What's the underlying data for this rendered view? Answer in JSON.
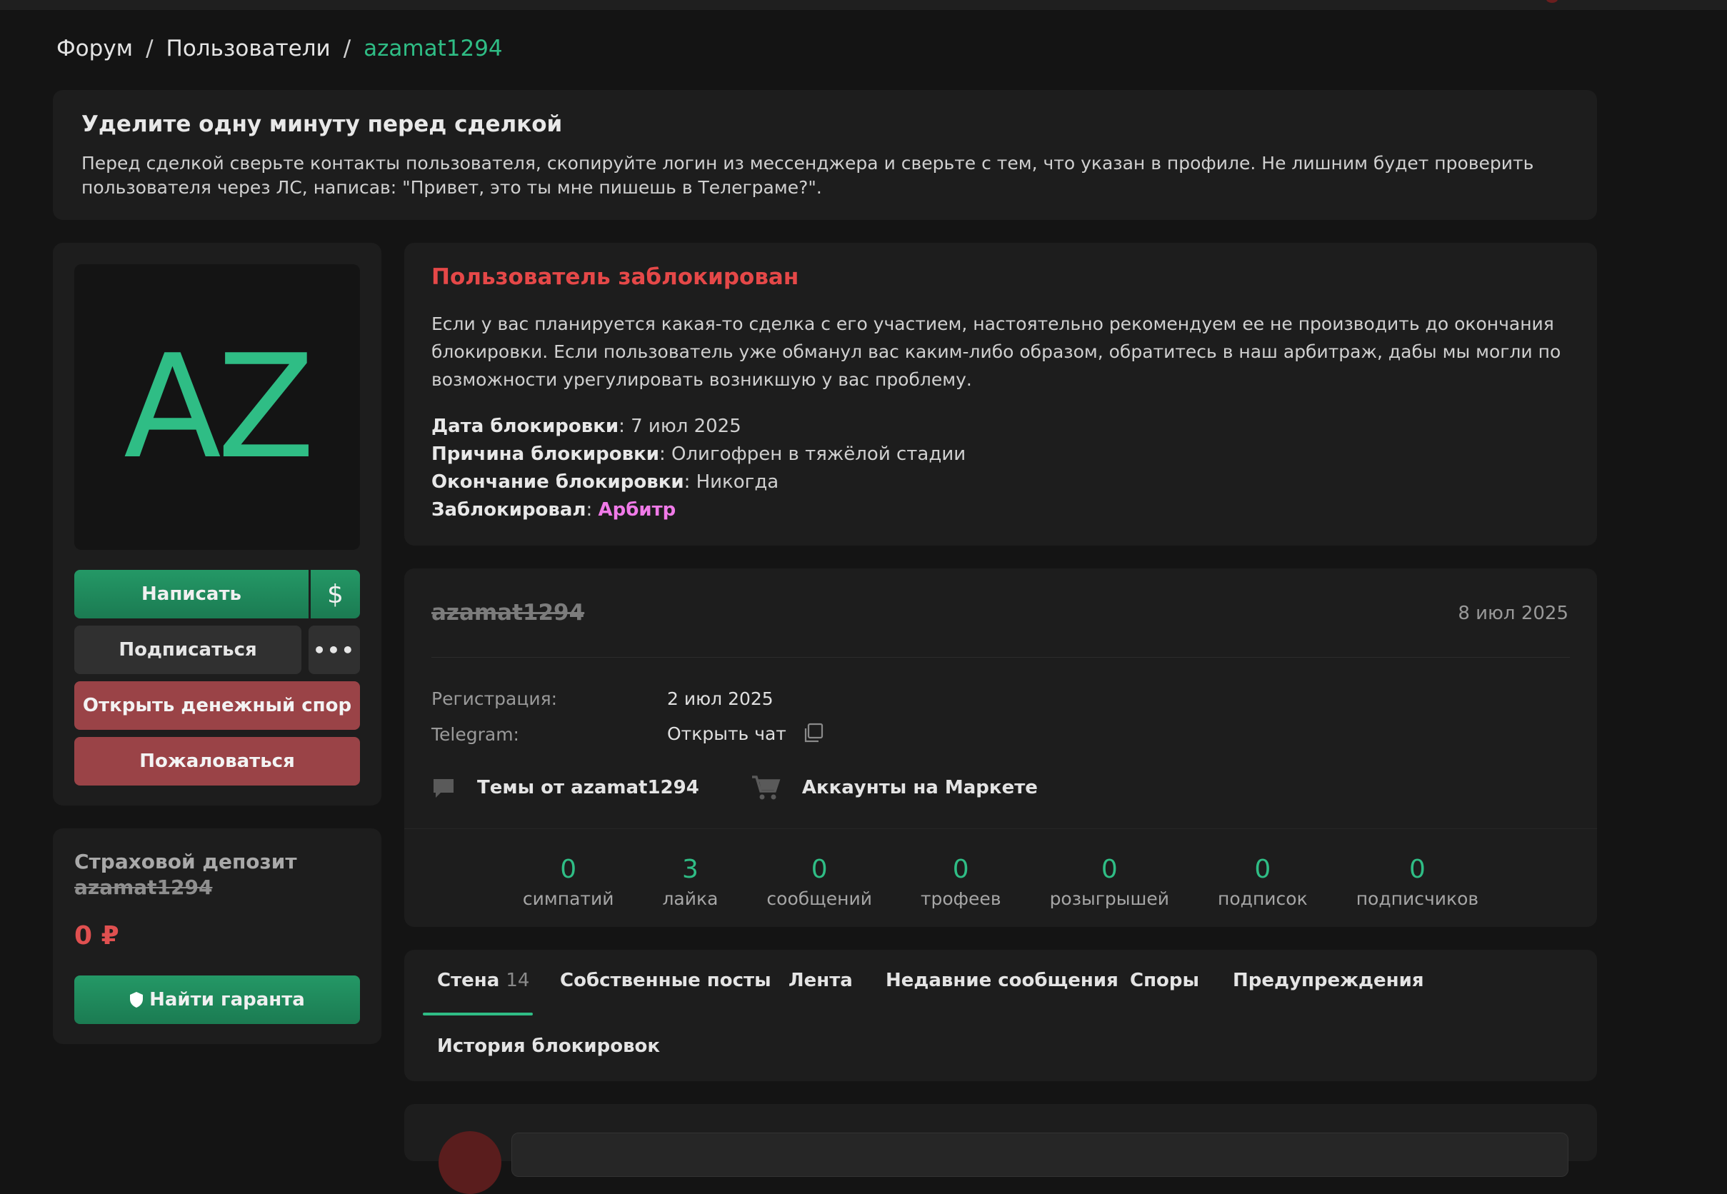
{
  "breadcrumb": {
    "forum": "Форум",
    "users": "Пользователи",
    "current": "azamat1294",
    "sep": "/"
  },
  "notice": {
    "title": "Уделите одну минуту перед сделкой",
    "text": "Перед сделкой сверьте контакты пользователя, скопируйте логин из мессенджера и сверьте с тем, что указан в профиле. Не лишним будет проверить пользователя через ЛС, написав: \"Привет, это ты мне пишешь в Телеграме?\"."
  },
  "profile": {
    "avatar_text": "AZ",
    "buttons": {
      "write": "Написать",
      "dollar": "$",
      "subscribe": "Подписаться",
      "more": "•••",
      "dispute": "Открыть денежный спор",
      "report": "Пожаловаться"
    }
  },
  "deposit": {
    "title": "Страховой депозит",
    "user": "azamat1294",
    "amount": "0 ₽",
    "button": "Найти гаранта"
  },
  "blocked": {
    "title": "Пользователь заблокирован",
    "text": "Если у вас планируется какая-то сделка с его участием, настоятельно рекомендуем ее не производить до окончания блокировки. Если пользователь уже обманул вас каким-либо образом, обратитесь в наш арбитраж, дабы мы могли по возможности урегулировать возникшую у вас проблему.",
    "rows": [
      {
        "label": "Дата блокировки",
        "value": "7 июл 2025"
      },
      {
        "label": "Причина блокировки",
        "value": "Олигофрен в тяжёлой стадии"
      },
      {
        "label": "Окончание блокировки",
        "value": "Никогда"
      },
      {
        "label": "Заблокировал",
        "value": "Арбитр"
      }
    ]
  },
  "info": {
    "username": "azamat1294",
    "date": "8 июл 2025",
    "registration_label": "Регистрация:",
    "registration_value": "2 июл 2025",
    "telegram_label": "Telegram:",
    "telegram_value": "Открыть чат",
    "topics_link": "Темы от azamat1294",
    "market_link": "Аккаунты на Маркете",
    "stats": [
      {
        "num": "0",
        "label": "симпатий"
      },
      {
        "num": "3",
        "label": "лайка"
      },
      {
        "num": "0",
        "label": "сообщений"
      },
      {
        "num": "0",
        "label": "трофеев"
      },
      {
        "num": "0",
        "label": "розыгрышей"
      },
      {
        "num": "0",
        "label": "подписок"
      },
      {
        "num": "0",
        "label": "подписчиков"
      }
    ]
  },
  "tabs": {
    "wall": "Стена",
    "wall_count": "14",
    "own_posts": "Собственные посты",
    "feed": "Лента",
    "recent": "Недавние сообщения",
    "disputes": "Споры",
    "warnings": "Предупреждения",
    "ban_history": "История блокировок"
  },
  "colors": {
    "accent": "#2fbd85",
    "danger": "#e54848",
    "arbiter": "#f07ae8",
    "background": "#141414",
    "card": "#1d1d1d"
  }
}
